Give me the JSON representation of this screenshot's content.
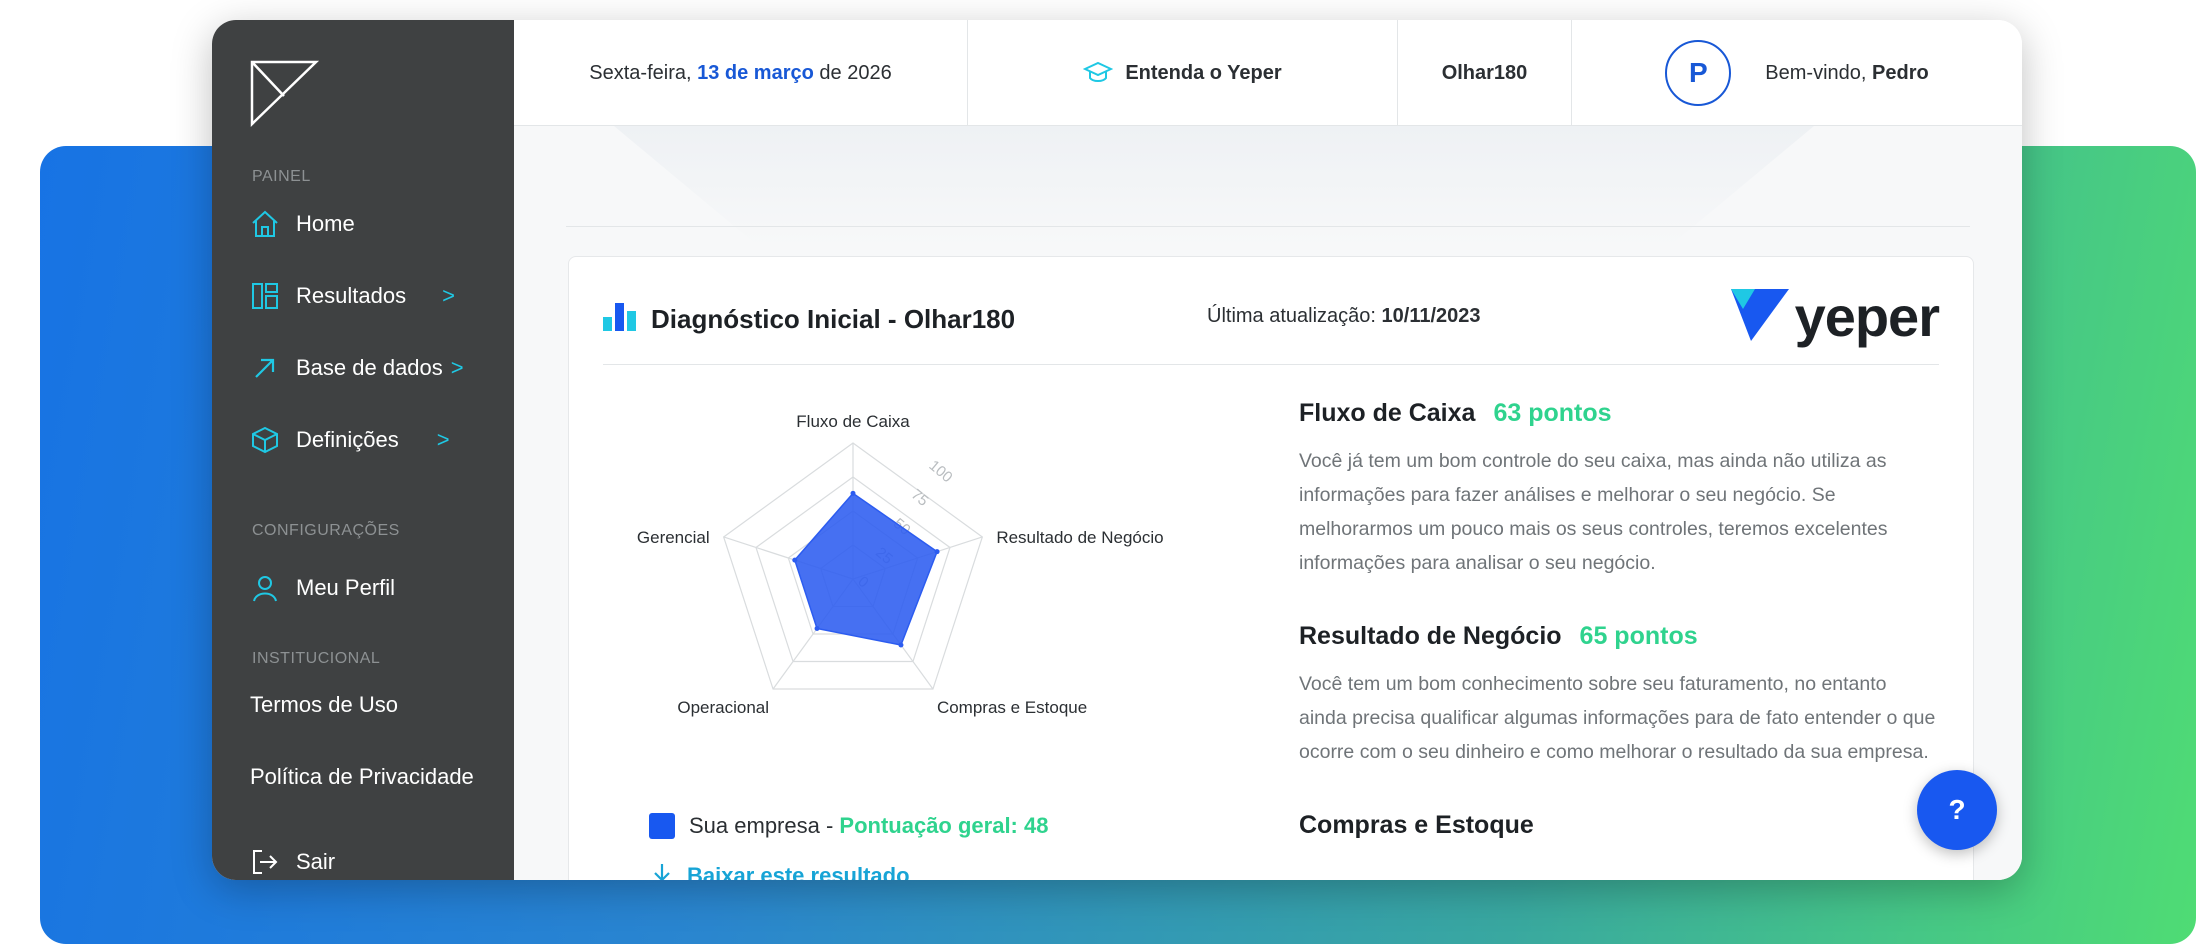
{
  "sidebar": {
    "painel_label": "PAINEL",
    "items": [
      {
        "label": "Home",
        "icon": "home-icon"
      },
      {
        "label": "Resultados",
        "icon": "results-icon"
      },
      {
        "label": "Base de dados",
        "icon": "arrow-up-right-icon"
      },
      {
        "label": "Definições",
        "icon": "cube-icon"
      }
    ],
    "config_label": "CONFIGURAÇÕES",
    "profile_label": "Meu Perfil",
    "institutional_label": "INSTITUCIONAL",
    "terms_label": "Termos de Uso",
    "privacy_label": "Política de Privacidade",
    "logout_label": "Sair",
    "chevron": ">"
  },
  "topbar": {
    "date_prefix": "Sexta-feira, ",
    "date_highlight": "13 de março",
    "date_suffix": " de 2026",
    "understand_label": "Entenda o Yeper",
    "olhar_label": "Olhar180",
    "avatar_initial": "P",
    "welcome_prefix": "Bem-vindo, ",
    "welcome_name": "Pedro"
  },
  "card": {
    "title": "Diagnóstico Inicial - Olhar180",
    "updated_label": "Última atualização: ",
    "updated_value": "10/11/2023",
    "brand": "yeper",
    "legend_label": "Sua empresa - ",
    "legend_score": "Pontuação geral: 48",
    "download_label": "Baixar este resultado"
  },
  "chart_data": {
    "type": "radar",
    "axes": [
      "Fluxo de Caixa",
      "Resultado de Negócio",
      "Compras e Estoque",
      "Operacional",
      "Gerencial"
    ],
    "ticks": [
      0,
      25,
      50,
      75,
      100
    ],
    "rmax": 100,
    "series": [
      {
        "values": [
          63,
          65,
          60,
          45,
          45
        ],
        "color": "#2c5cf0"
      }
    ]
  },
  "sections": [
    {
      "name": "Fluxo de Caixa",
      "points": "63 pontos",
      "text": "Você já tem um bom controle do seu caixa, mas ainda não utiliza as informações para fazer análises e melhorar o seu negócio. Se melhorarmos um pouco mais os seus controles, teremos excelentes informações para analisar o seu negócio."
    },
    {
      "name": "Resultado de Negócio",
      "points": "65 pontos",
      "text": "Você tem um bom conhecimento sobre seu faturamento, no entanto ainda precisa qualificar algumas informações para de fato entender o que ocorre com o seu dinheiro e como melhorar o resultado da sua empresa."
    },
    {
      "name": "Compras e Estoque"
    }
  ],
  "help_label": "?"
}
